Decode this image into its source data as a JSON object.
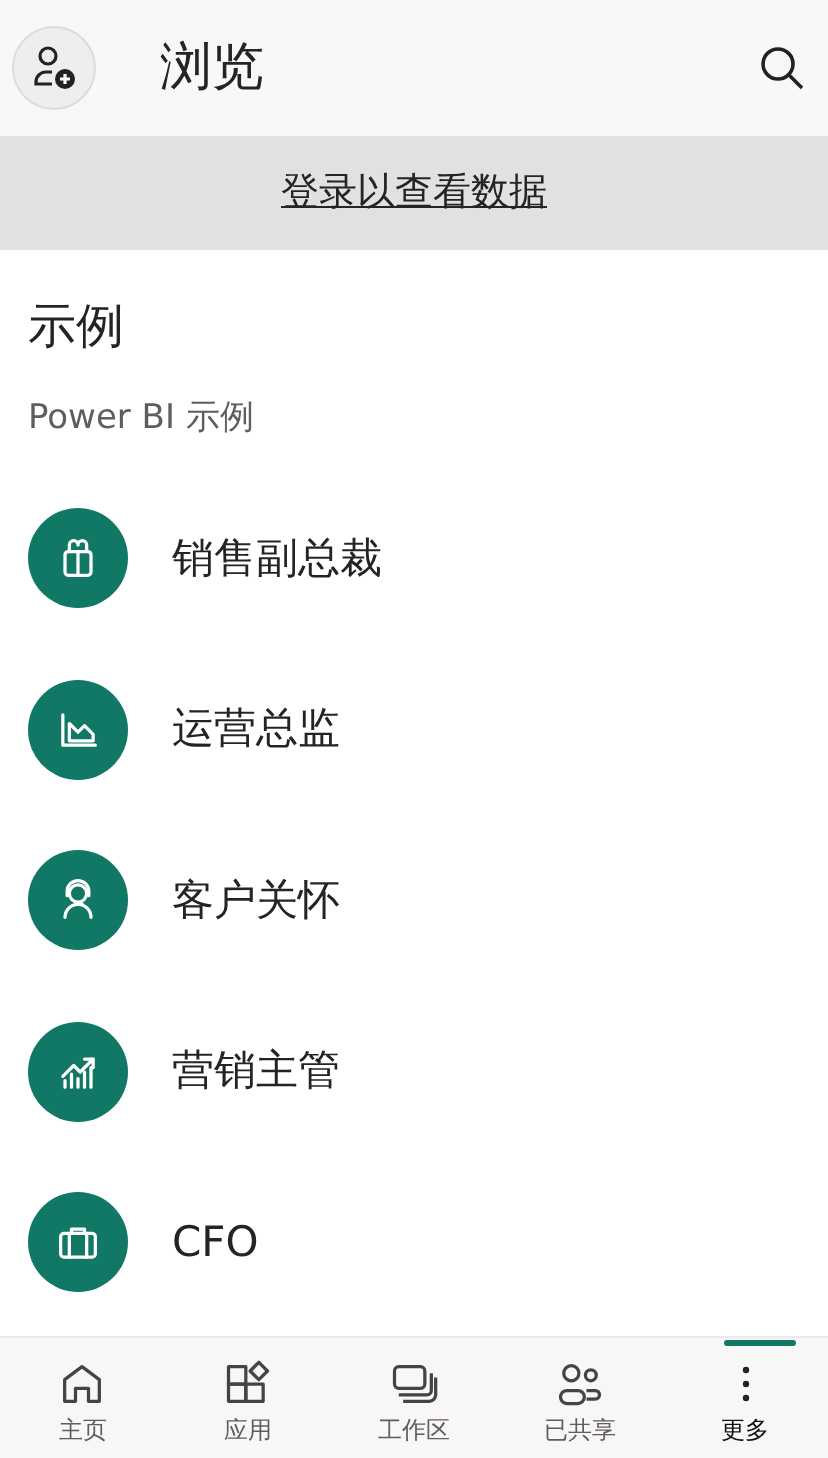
{
  "header": {
    "title": "浏览"
  },
  "banner": {
    "link": "登录以查看数据"
  },
  "section": {
    "title": "示例",
    "subtitle": "Power BI 示例"
  },
  "items": [
    {
      "label": "销售副总裁",
      "kind": "gift"
    },
    {
      "label": "运营总监",
      "kind": "chart"
    },
    {
      "label": "客户关怀",
      "kind": "headset"
    },
    {
      "label": "营销主管",
      "kind": "trend"
    },
    {
      "label": "CFO",
      "kind": "briefcase"
    }
  ],
  "nav": [
    {
      "label": "主页",
      "kind": "home",
      "selected": false
    },
    {
      "label": "应用",
      "kind": "apps",
      "selected": false
    },
    {
      "label": "工作区",
      "kind": "workspace",
      "selected": false
    },
    {
      "label": "已共享",
      "kind": "shared",
      "selected": false
    },
    {
      "label": "更多",
      "kind": "more",
      "selected": true
    }
  ]
}
